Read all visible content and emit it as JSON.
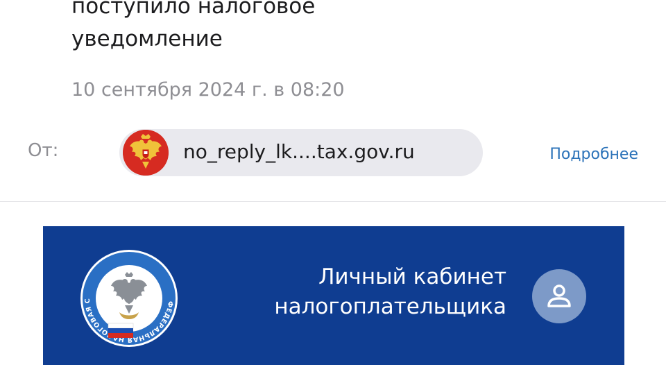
{
  "message": {
    "subject_lines": [
      "поступило налоговое",
      "уведомление"
    ],
    "date": "10 сентября 2024 г. в 08:20",
    "from_label": "От:",
    "sender": "no_reply_lk....tax.gov.ru",
    "details_link": "Подробнее"
  },
  "banner": {
    "logo_ring_text": "ФЕДЕРАЛЬНАЯ НАЛОГОВАЯ СЛУЖБА",
    "title_lines": [
      "Личный кабинет",
      "налогоплательщика"
    ],
    "profile_icon": "user-icon"
  },
  "colors": {
    "banner_bg": "#0f3d91",
    "link": "#2c73b9",
    "avatar_red": "#d62b21",
    "muted_text": "#8e8e93"
  }
}
